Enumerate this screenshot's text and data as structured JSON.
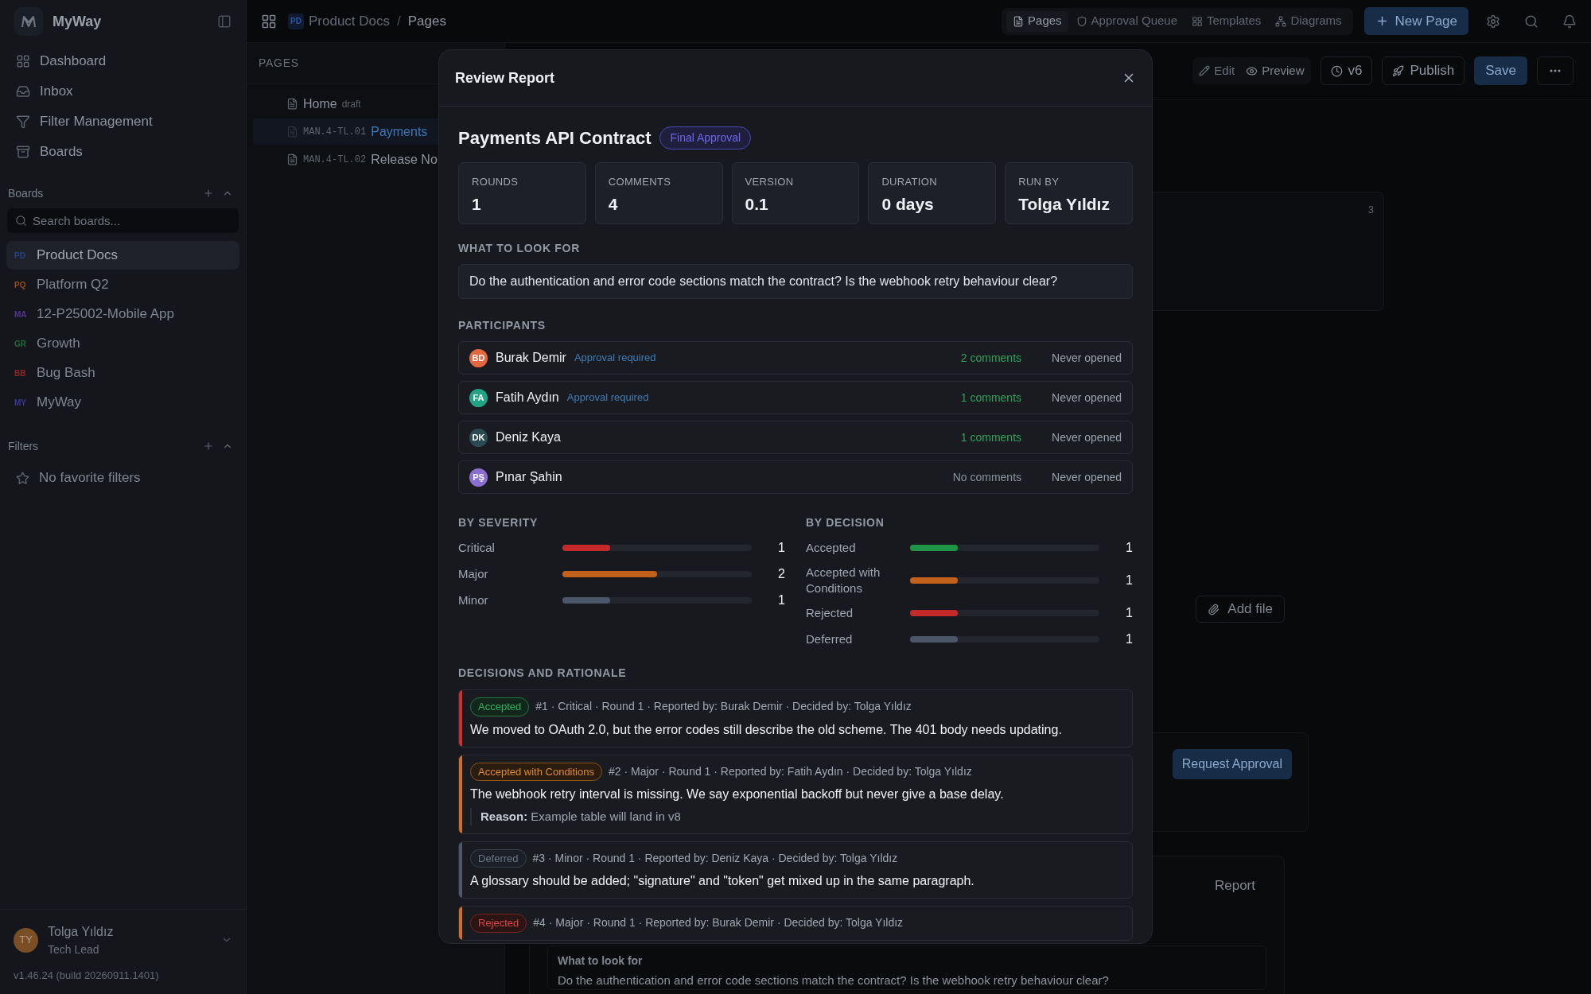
{
  "sidebar": {
    "app_name": "MyWay",
    "nav": [
      {
        "kind": "dashboard",
        "label": "Dashboard"
      },
      {
        "kind": "inbox",
        "label": "Inbox"
      },
      {
        "kind": "filter",
        "label": "Filter Management"
      },
      {
        "kind": "boards",
        "label": "Boards"
      }
    ],
    "boards": {
      "title": "Boards",
      "search_placeholder": "Search boards...",
      "items": [
        {
          "initials": "PD",
          "name": "Product Docs",
          "color": "#27458a",
          "selected": true
        },
        {
          "initials": "PQ",
          "name": "Platform Q2",
          "color": "#9a4a1c",
          "selected": false
        },
        {
          "initials": "MA",
          "name": "12-P25002-Mobile App",
          "color": "#563396",
          "selected": false
        },
        {
          "initials": "GR",
          "name": "Growth",
          "color": "#1d6b3c",
          "selected": false
        },
        {
          "initials": "BB",
          "name": "Bug Bash",
          "color": "#8e2626",
          "selected": false
        },
        {
          "initials": "MY",
          "name": "MyWay",
          "color": "#3d389e",
          "selected": false
        }
      ]
    },
    "filters": {
      "title": "Filters",
      "empty": "No favorite filters"
    },
    "user": {
      "initials": "TY",
      "name": "Tolga Yıldız",
      "role": "Tech Lead"
    },
    "version": "v1.46.24 (build 20260911.1401)"
  },
  "topbar": {
    "board_initials": "PD",
    "board": "Product Docs",
    "separator": "/",
    "page": "Pages",
    "tabs": [
      {
        "kind": "pages",
        "label": "Pages",
        "selected": true
      },
      {
        "kind": "approval",
        "label": "Approval Queue",
        "selected": false
      },
      {
        "kind": "templates",
        "label": "Templates",
        "selected": false
      },
      {
        "kind": "diagrams",
        "label": "Diagrams",
        "selected": false
      }
    ],
    "new_page": "New Page"
  },
  "pages_panel": {
    "title": "PAGES",
    "items": [
      {
        "title": "Home",
        "tag": "draft",
        "selected": false
      },
      {
        "code": "MAN.4-TL.01",
        "title": "Payments",
        "selected": true
      },
      {
        "code": "MAN.4-TL.02",
        "title": "Release No",
        "selected": false
      }
    ]
  },
  "editor": {
    "edit": "Edit",
    "preview": "Preview",
    "version": "v6",
    "publish": "Publish",
    "save": "Save",
    "card_count": "3",
    "add_file": "Add file",
    "request_approval": "Request Approval",
    "report": "Report",
    "look_for_label": "What to look for",
    "look_for_text": "Do the authentication and error code sections match the contract? Is the webhook retry behaviour clear?"
  },
  "modal": {
    "title": "Review Report",
    "doc_title": "Payments API Contract",
    "stage": "Final Approval",
    "stats": [
      {
        "label": "ROUNDS",
        "value": "1"
      },
      {
        "label": "COMMENTS",
        "value": "4"
      },
      {
        "label": "VERSION",
        "value": "0.1"
      },
      {
        "label": "DURATION",
        "value": "0 days"
      },
      {
        "label": "RUN BY",
        "value": "Tolga Yıldız"
      }
    ],
    "look_for": {
      "heading": "WHAT TO LOOK FOR",
      "text": "Do the authentication and error code sections match the contract? Is the webhook retry behaviour clear?"
    },
    "participants": {
      "heading": "PARTICIPANTS",
      "rows": [
        {
          "initials": "BD",
          "name": "Burak Demir",
          "color": "#e4683f",
          "approval": "Approval required",
          "comments": "2 comments",
          "has_comments": true,
          "status": "Never opened"
        },
        {
          "initials": "FA",
          "name": "Fatih Aydın",
          "color": "#22a386",
          "approval": "Approval required",
          "comments": "1 comments",
          "has_comments": true,
          "status": "Never opened"
        },
        {
          "initials": "DK",
          "name": "Deniz Kaya",
          "color": "#2c4a52",
          "comments": "1 comments",
          "has_comments": true,
          "status": "Never opened"
        },
        {
          "initials": "PŞ",
          "name": "Pınar Şahin",
          "color": "#8a6fd0",
          "comments": "No comments",
          "has_comments": false,
          "status": "Never opened"
        }
      ]
    },
    "by_severity": {
      "heading": "BY SEVERITY",
      "rows": [
        {
          "label": "Critical",
          "count": "1",
          "level": 0.25,
          "color": "#c52a2a"
        },
        {
          "label": "Major",
          "count": "2",
          "level": 0.5,
          "color": "#c2621a"
        },
        {
          "label": "Minor",
          "count": "1",
          "level": 0.25,
          "color": "#4b5668"
        }
      ]
    },
    "by_decision": {
      "heading": "BY DECISION",
      "rows": [
        {
          "label": "Accepted",
          "count": "1",
          "level": 0.25,
          "color": "#1f9447"
        },
        {
          "label": "Accepted with Conditions",
          "count": "1",
          "level": 0.25,
          "color": "#c2621a"
        },
        {
          "label": "Rejected",
          "count": "1",
          "level": 0.25,
          "color": "#c52a2a"
        },
        {
          "label": "Deferred",
          "count": "1",
          "level": 0.25,
          "color": "#4b5668"
        }
      ]
    },
    "decisions": {
      "heading": "DECISIONS AND RATIONALE",
      "items": [
        {
          "kind": "accepted",
          "color": "#d12f2f",
          "badge": "Accepted",
          "meta": "#1 · Critical · Round 1 · Reported by: Burak Demir · Decided by: Tolga Yıldız",
          "text": "We moved to OAuth 2.0, but the error codes still describe the old scheme. The 401 body needs updating."
        },
        {
          "kind": "conditions",
          "color": "#d0701e",
          "badge": "Accepted with Conditions",
          "meta": "#2 · Major · Round 1 · Reported by: Fatih Aydın · Decided by: Tolga Yıldız",
          "text": "The webhook retry interval is missing. We say exponential backoff but never give a base delay.",
          "reason": "**Reason:** Example table will land in v8"
        },
        {
          "kind": "deferred",
          "color": "#4e5a6c",
          "badge": "Deferred",
          "meta": "#3 · Minor · Round 1 · Reported by: Deniz Kaya · Decided by: Tolga Yıldız",
          "text": "A glossary should be added; \"signature\" and \"token\" get mixed up in the same paragraph."
        },
        {
          "kind": "rejected",
          "color": "#d0701e",
          "badge": "Rejected",
          "meta": "#4 · Major · Round 1 · Reported by: Burak Demir · Decided by: Tolga Yıldız"
        }
      ]
    }
  }
}
